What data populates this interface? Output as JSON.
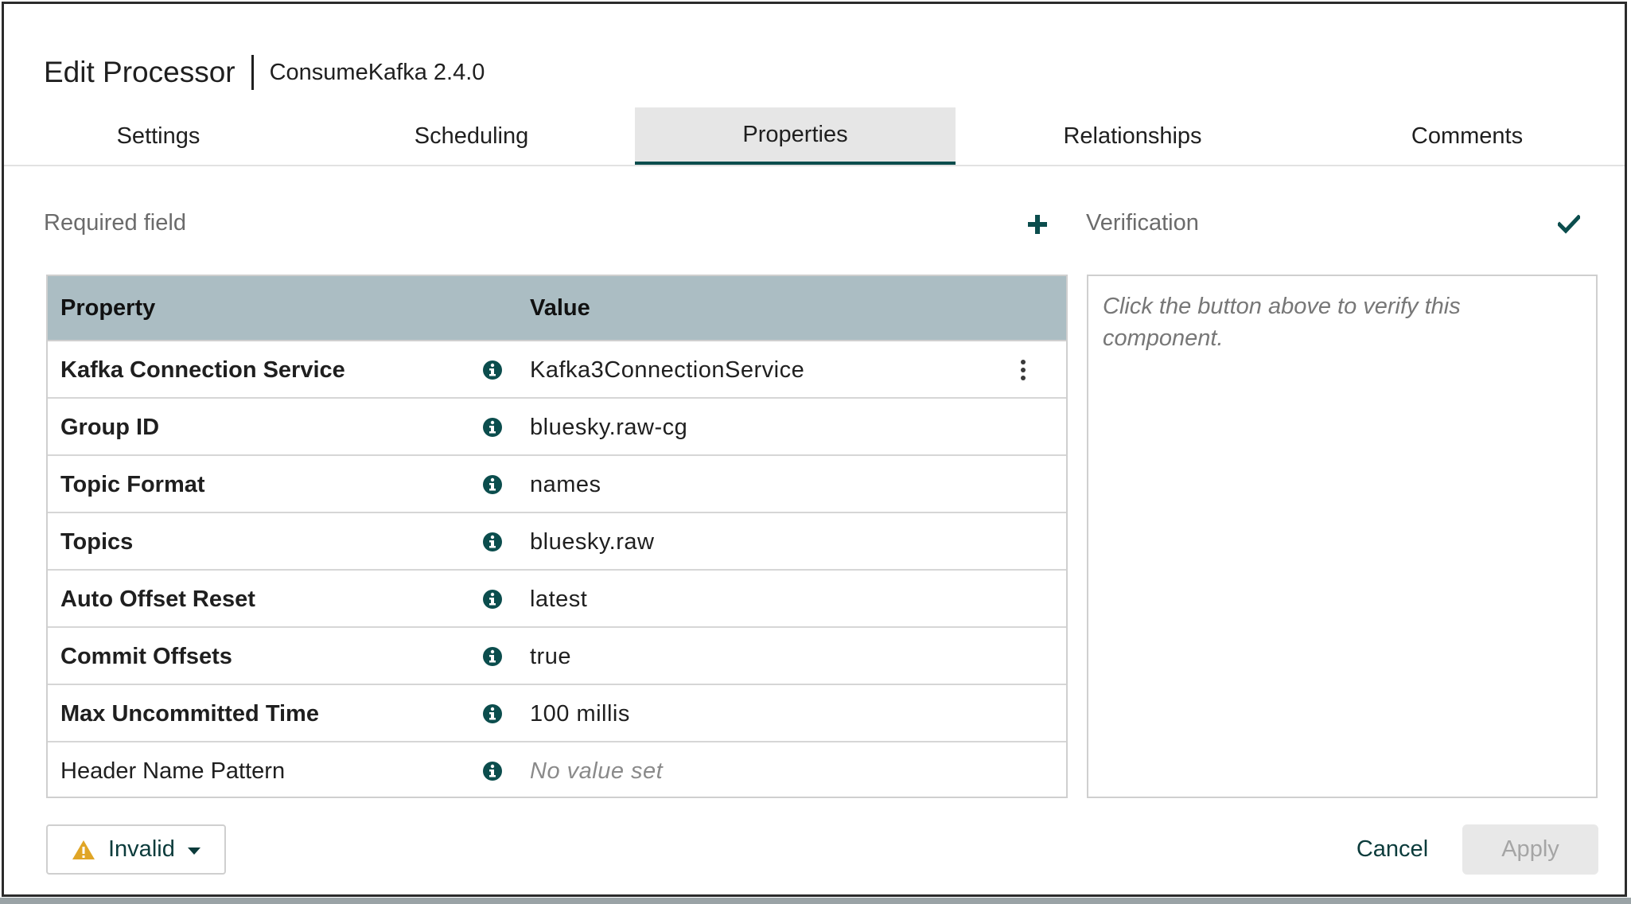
{
  "header": {
    "title": "Edit Processor",
    "subtitle": "ConsumeKafka 2.4.0"
  },
  "tabs": [
    {
      "label": "Settings",
      "active": false
    },
    {
      "label": "Scheduling",
      "active": false
    },
    {
      "label": "Properties",
      "active": true
    },
    {
      "label": "Relationships",
      "active": false
    },
    {
      "label": "Comments",
      "active": false
    }
  ],
  "properties_section": {
    "required_label": "Required field",
    "add_icon": "plus-icon"
  },
  "verification_section": {
    "label": "Verification",
    "verify_icon": "checkmark-icon",
    "placeholder": "Click the button above to verify this component."
  },
  "table": {
    "headers": {
      "property": "Property",
      "value": "Value"
    },
    "rows": [
      {
        "name": "Kafka Connection Service",
        "value": "Kafka3ConnectionService",
        "required": true,
        "has_menu": true,
        "empty": false
      },
      {
        "name": "Group ID",
        "value": "bluesky.raw-cg",
        "required": true,
        "has_menu": false,
        "empty": false
      },
      {
        "name": "Topic Format",
        "value": "names",
        "required": true,
        "has_menu": false,
        "empty": false
      },
      {
        "name": "Topics",
        "value": "bluesky.raw",
        "required": true,
        "has_menu": false,
        "empty": false
      },
      {
        "name": "Auto Offset Reset",
        "value": "latest",
        "required": true,
        "has_menu": false,
        "empty": false
      },
      {
        "name": "Commit Offsets",
        "value": "true",
        "required": true,
        "has_menu": false,
        "empty": false
      },
      {
        "name": "Max Uncommitted Time",
        "value": "100 millis",
        "required": true,
        "has_menu": false,
        "empty": false
      },
      {
        "name": "Header Name Pattern",
        "value": "No value set",
        "required": false,
        "has_menu": false,
        "empty": true
      }
    ]
  },
  "footer": {
    "status_label": "Invalid",
    "cancel_label": "Cancel",
    "apply_label": "Apply",
    "apply_enabled": false
  },
  "colors": {
    "accent": "#0b4d4d",
    "header_bg": "#abbdc3",
    "warning": "#e0a526"
  }
}
